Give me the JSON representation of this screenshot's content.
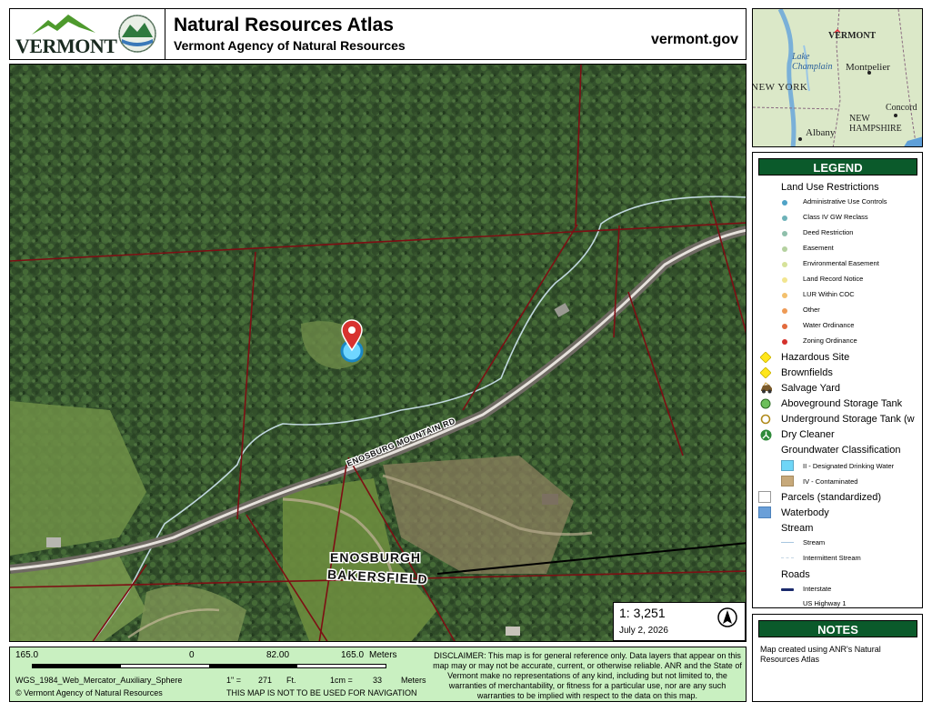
{
  "header": {
    "logo_text": "VERMONT",
    "title": "Natural Resources Atlas",
    "subtitle": "Vermont Agency of Natural Resources",
    "site": "vermont.gov"
  },
  "map": {
    "road_label": "ENOSBURG MOUNTAIN RD",
    "town_1": "ENOSBURGH",
    "town_2": "BAKERSFIELD",
    "scale_ratio": "1:  3,251",
    "date": "July 2, 2026",
    "marker_icon": "map-pin-icon",
    "north_icon": "north-arrow-icon"
  },
  "inset": {
    "labels": [
      "VERMONT",
      "Lake Champlain",
      "Montpelier",
      "NEW YORK",
      "Concord",
      "NEW HAMPSHIRE",
      "Albany"
    ]
  },
  "legend": {
    "heading": "LEGEND",
    "land_use_heading": "Land Use Restrictions",
    "land_use_items": [
      {
        "label": "Administrative Use Controls",
        "color": "#4fa3c7"
      },
      {
        "label": "Class IV GW Reclass",
        "color": "#6db2b8"
      },
      {
        "label": "Deed Restriction",
        "color": "#8fbfab"
      },
      {
        "label": "Easement",
        "color": "#b4d19f"
      },
      {
        "label": "Environmental Easement",
        "color": "#d6e29a"
      },
      {
        "label": "Land Record Notice",
        "color": "#f2e58f"
      },
      {
        "label": "LUR Within COC",
        "color": "#f3c06d"
      },
      {
        "label": "Other",
        "color": "#ee9a55"
      },
      {
        "label": "Water Ordinance",
        "color": "#e26b3d"
      },
      {
        "label": "Zoning Ordinance",
        "color": "#d4312c"
      }
    ],
    "hazardous_site": "Hazardous Site",
    "brownfields": "Brownfields",
    "salvage_yard": "Salvage Yard",
    "aboveground_tank": "Aboveground Storage Tank",
    "underground_tank": "Underground Storage Tank (w",
    "dry_cleaner": "Dry Cleaner",
    "groundwater_heading": "Groundwater Classification",
    "gw_designated": "II - Designated Drinking Water",
    "gw_contaminated": "IV - Contaminated",
    "parcels": "Parcels (standardized)",
    "waterbody": "Waterbody",
    "stream_heading": "Stream",
    "stream": "Stream",
    "intermittent_stream": "Intermittent Stream",
    "roads_heading": "Roads",
    "interstate": "Interstate",
    "us_highway": "US Highway 1"
  },
  "notes": {
    "heading": "NOTES",
    "text": "Map created using ANR's Natural Resources Atlas"
  },
  "footer": {
    "scale_left": "165.0",
    "scale_zero": "0",
    "scale_mid": "82.00",
    "scale_right": "165.0",
    "scale_unit": "Meters",
    "projection": "WGS_1984_Web_Mercator_Auxiliary_Sphere",
    "inch_eq": "1\" =",
    "inch_val": "271",
    "inch_unit": "Ft.",
    "cm_eq": "1cm =",
    "cm_val": "33",
    "cm_unit": "Meters",
    "copyright": "© Vermont Agency of Natural Resources",
    "nav_warning": "THIS MAP IS NOT TO BE USED FOR NAVIGATION",
    "disclaimer": "DISCLAIMER: This map is for general reference only. Data layers that appear on this map may or may not be accurate, current, or otherwise reliable. ANR and the State of Vermont make no representations of any kind, including but not limited to, the warranties of merchantability, or fitness for a particular use, nor are any such warranties to be implied with respect to the data on this map."
  }
}
